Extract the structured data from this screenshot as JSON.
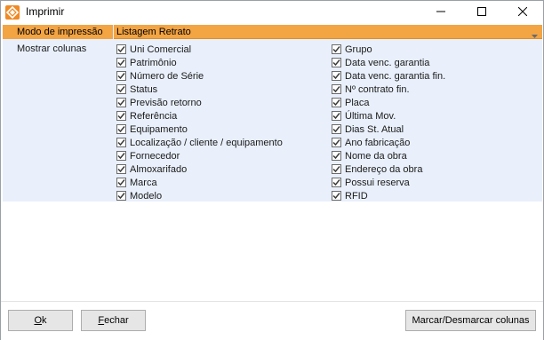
{
  "window": {
    "title": "Imprimir",
    "controls": [
      "minimize-icon",
      "maximize-icon",
      "close-icon"
    ]
  },
  "form": {
    "mode_label": "Modo de impressão",
    "mode_value": "Listagem Retrato",
    "columns_label": "Mostrar colunas",
    "left_columns": [
      {
        "label": "Uni Comercial",
        "checked": true
      },
      {
        "label": "Patrimônio",
        "checked": true
      },
      {
        "label": "Número de Série",
        "checked": true
      },
      {
        "label": "Status",
        "checked": true
      },
      {
        "label": "Previsão retorno",
        "checked": true
      },
      {
        "label": "Referência",
        "checked": true
      },
      {
        "label": "Equipamento",
        "checked": true
      },
      {
        "label": "Localização / cliente / equipamento",
        "checked": true
      },
      {
        "label": "Fornecedor",
        "checked": true
      },
      {
        "label": "Almoxarifado",
        "checked": true
      },
      {
        "label": "Marca",
        "checked": true
      },
      {
        "label": "Modelo",
        "checked": true
      }
    ],
    "right_columns": [
      {
        "label": "Grupo",
        "checked": true
      },
      {
        "label": "Data venc. garantia",
        "checked": true
      },
      {
        "label": "Data venc. garantia fin.",
        "checked": true
      },
      {
        "label": "Nº contrato fin.",
        "checked": true
      },
      {
        "label": "Placa",
        "checked": true
      },
      {
        "label": "Última Mov.",
        "checked": true
      },
      {
        "label": "Dias St. Atual",
        "checked": true
      },
      {
        "label": "Ano fabricação",
        "checked": true
      },
      {
        "label": "Nome da obra",
        "checked": true
      },
      {
        "label": "Endereço da obra",
        "checked": true
      },
      {
        "label": "Possui reserva",
        "checked": true
      },
      {
        "label": "RFID",
        "checked": true
      }
    ]
  },
  "buttons": {
    "ok_access": "O",
    "ok_rest": "k",
    "fechar_access": "F",
    "fechar_rest": "echar",
    "toggle_label": "Marcar/Desmarcar colunas"
  },
  "colors": {
    "accent": "#f3a443",
    "form_bg": "#e9f0fb",
    "button_bg": "#e6e6e6"
  }
}
